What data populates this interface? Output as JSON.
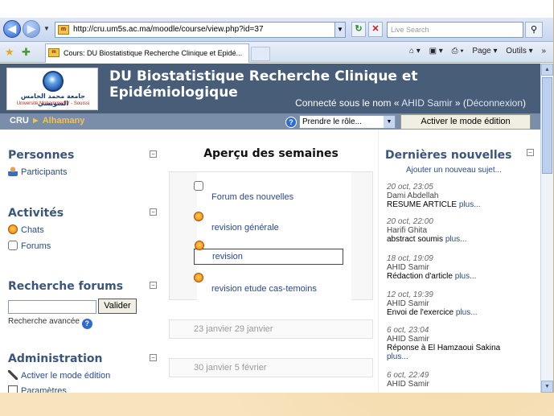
{
  "browser": {
    "address": "http://cru.um5s.ac.ma/moodle/course/view.php?id=37",
    "search_placeholder": "Live Search",
    "tab_title": "Cours: DU Biostatistique Recherche Clinique et Epidé...",
    "tools": {
      "page": "Page ▾",
      "outils": "Outils ▾"
    }
  },
  "header": {
    "logo_arabic": "جامعة محمد الخامس السويسي",
    "logo_latin": "Université Mohammed V - Souissi",
    "title": "DU Biostatistique Recherche Clinique et Epidémiologique",
    "login_prefix": "Connecté sous le nom «",
    "user": "AHID Samir",
    "login_mid": "» (",
    "logout": "Déconnexion",
    "login_suffix": ")"
  },
  "navbar": {
    "crumb_root": "CRU",
    "crumb_sep": "►",
    "crumb_current": "Alhamany",
    "role_select": "Prendre le rôle...",
    "edit_button": "Activer le mode édition"
  },
  "left": {
    "personnes": {
      "title": "Personnes",
      "participants": "Participants"
    },
    "activites": {
      "title": "Activités",
      "chats": "Chats",
      "forums": "Forums"
    },
    "recherche": {
      "title": "Recherche forums",
      "button": "Valider",
      "advanced": "Recherche avancée"
    },
    "admin": {
      "title": "Administration",
      "edit_mode": "Activer le mode édition",
      "parametres": "Paramètres"
    }
  },
  "center": {
    "title": "Aperçu des semaines",
    "activities": [
      "Forum des nouvelles",
      "revision générale",
      "revision",
      "revision etude cas-temoins"
    ],
    "weeks": [
      "23 janvier 29 janvier",
      "30 janvier 5 février"
    ]
  },
  "right": {
    "title": "Dernières nouvelles",
    "add": "Ajouter un nouveau sujet...",
    "items": [
      {
        "date": "20 oct, 23:05",
        "author": "Dami Abdellah",
        "subject": "RESUME ARTICLE",
        "more": "plus..."
      },
      {
        "date": "20 oct, 22:00",
        "author": "Harifi Ghita",
        "subject": "abstract soumis",
        "more": "plus..."
      },
      {
        "date": "18 oct, 19:09",
        "author": "AHID Samir",
        "subject": "Rédaction d'article",
        "more": "plus..."
      },
      {
        "date": "12 oct, 19:39",
        "author": "AHID Samir",
        "subject": "Envoi de l'exercice",
        "more": "plus..."
      },
      {
        "date": "6 oct, 23:04",
        "author": "AHID Samir",
        "subject": "Réponse à El Hamzaoui Sakina",
        "more": "plus..."
      },
      {
        "date": "6 oct, 22:49",
        "author": "AHID Samir",
        "subject": "",
        "more": ""
      }
    ]
  }
}
